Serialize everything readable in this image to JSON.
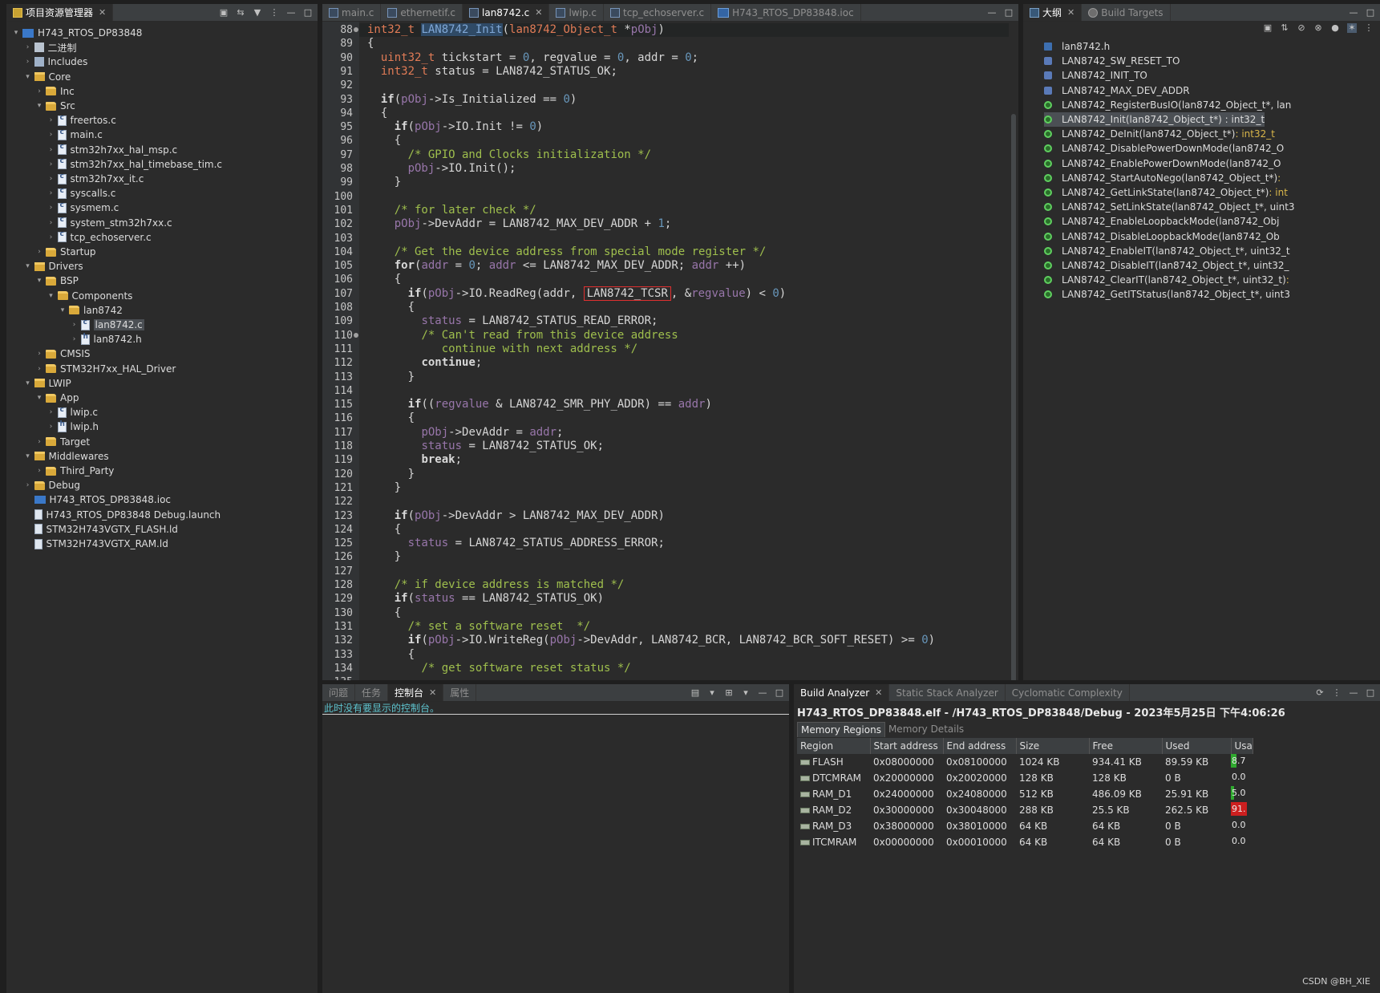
{
  "explorer": {
    "tab_label": "项目资源管理器",
    "tree": [
      {
        "depth": 0,
        "arrow": "▾",
        "icon": "ide",
        "label": "H743_RTOS_DP83848"
      },
      {
        "depth": 1,
        "arrow": "›",
        "icon": "bin",
        "label": "二进制"
      },
      {
        "depth": 1,
        "arrow": "›",
        "icon": "inc",
        "label": "Includes"
      },
      {
        "depth": 1,
        "arrow": "▾",
        "icon": "fold-src",
        "label": "Core"
      },
      {
        "depth": 2,
        "arrow": "›",
        "icon": "fold",
        "label": "Inc"
      },
      {
        "depth": 2,
        "arrow": "▾",
        "icon": "fold",
        "label": "Src"
      },
      {
        "depth": 3,
        "arrow": "›",
        "icon": "cfile",
        "label": "freertos.c"
      },
      {
        "depth": 3,
        "arrow": "›",
        "icon": "cfile",
        "label": "main.c"
      },
      {
        "depth": 3,
        "arrow": "›",
        "icon": "cfile",
        "label": "stm32h7xx_hal_msp.c"
      },
      {
        "depth": 3,
        "arrow": "›",
        "icon": "cfile",
        "label": "stm32h7xx_hal_timebase_tim.c"
      },
      {
        "depth": 3,
        "arrow": "›",
        "icon": "cfile",
        "label": "stm32h7xx_it.c"
      },
      {
        "depth": 3,
        "arrow": "›",
        "icon": "cfile",
        "label": "syscalls.c"
      },
      {
        "depth": 3,
        "arrow": "›",
        "icon": "cfile",
        "label": "sysmem.c"
      },
      {
        "depth": 3,
        "arrow": "›",
        "icon": "cfile",
        "label": "system_stm32h7xx.c"
      },
      {
        "depth": 3,
        "arrow": "›",
        "icon": "cfile",
        "label": "tcp_echoserver.c"
      },
      {
        "depth": 2,
        "arrow": "›",
        "icon": "fold",
        "label": "Startup"
      },
      {
        "depth": 1,
        "arrow": "▾",
        "icon": "fold-src",
        "label": "Drivers"
      },
      {
        "depth": 2,
        "arrow": "▾",
        "icon": "fold",
        "label": "BSP"
      },
      {
        "depth": 3,
        "arrow": "▾",
        "icon": "fold",
        "label": "Components"
      },
      {
        "depth": 4,
        "arrow": "▾",
        "icon": "fold",
        "label": "lan8742"
      },
      {
        "depth": 5,
        "arrow": "›",
        "icon": "cfile",
        "label": "lan8742.c",
        "selected": true
      },
      {
        "depth": 5,
        "arrow": "›",
        "icon": "hfile",
        "label": "lan8742.h"
      },
      {
        "depth": 2,
        "arrow": "›",
        "icon": "fold",
        "label": "CMSIS"
      },
      {
        "depth": 2,
        "arrow": "›",
        "icon": "fold",
        "label": "STM32H7xx_HAL_Driver"
      },
      {
        "depth": 1,
        "arrow": "▾",
        "icon": "fold-src",
        "label": "LWIP"
      },
      {
        "depth": 2,
        "arrow": "▾",
        "icon": "fold",
        "label": "App"
      },
      {
        "depth": 3,
        "arrow": "›",
        "icon": "cfile",
        "label": "lwip.c"
      },
      {
        "depth": 3,
        "arrow": "›",
        "icon": "hfile",
        "label": "lwip.h"
      },
      {
        "depth": 2,
        "arrow": "›",
        "icon": "fold",
        "label": "Target"
      },
      {
        "depth": 1,
        "arrow": "▾",
        "icon": "fold-src",
        "label": "Middlewares"
      },
      {
        "depth": 2,
        "arrow": "›",
        "icon": "fold",
        "label": "Third_Party"
      },
      {
        "depth": 1,
        "arrow": "›",
        "icon": "fold",
        "label": "Debug"
      },
      {
        "depth": 1,
        "arrow": "",
        "icon": "mx",
        "label": "H743_RTOS_DP83848.ioc"
      },
      {
        "depth": 1,
        "arrow": "",
        "icon": "doc",
        "label": "H743_RTOS_DP83848 Debug.launch"
      },
      {
        "depth": 1,
        "arrow": "",
        "icon": "doc",
        "label": "STM32H743VGTX_FLASH.ld"
      },
      {
        "depth": 1,
        "arrow": "",
        "icon": "doc",
        "label": "STM32H743VGTX_RAM.ld"
      }
    ]
  },
  "editor": {
    "tabs": [
      {
        "label": "main.c",
        "icon": "c",
        "active": false
      },
      {
        "label": "ethernetif.c",
        "icon": "c",
        "active": false
      },
      {
        "label": "lan8742.c",
        "icon": "c",
        "active": true
      },
      {
        "label": "lwip.c",
        "icon": "c",
        "active": false
      },
      {
        "label": "tcp_echoserver.c",
        "icon": "c",
        "active": false
      },
      {
        "label": "H743_RTOS_DP83848.ioc",
        "icon": "mx",
        "active": false
      }
    ],
    "lines": [
      {
        "n": "88",
        "html": "<span class=\"ty\">int32_t</span> <span class=\"fnsel\">LAN8742_Init</span>(<span class=\"ty\">lan8742_Object_t</span> *<span class=\"var\">pObj</span>)",
        "current": true,
        "mark": true
      },
      {
        "n": "89",
        "html": "{"
      },
      {
        "n": "90",
        "html": "  <span class=\"ty\">uint32_t</span> tickstart = <span class=\"num\">0</span>, regvalue = <span class=\"num\">0</span>, addr = <span class=\"num\">0</span>;"
      },
      {
        "n": "91",
        "html": "  <span class=\"ty\">int32_t</span> status = LAN8742_STATUS_OK;"
      },
      {
        "n": "92",
        "html": ""
      },
      {
        "n": "93",
        "html": "  <span class=\"kwp\">if</span>(<span class=\"var\">pObj</span>->Is_Initialized == <span class=\"num\">0</span>)"
      },
      {
        "n": "94",
        "html": "  {"
      },
      {
        "n": "95",
        "html": "    <span class=\"kwp\">if</span>(<span class=\"var\">pObj</span>->IO.Init != <span class=\"num\">0</span>)"
      },
      {
        "n": "96",
        "html": "    {"
      },
      {
        "n": "97",
        "html": "      <span class=\"cm\">/* GPIO and Clocks initialization */</span>"
      },
      {
        "n": "98",
        "html": "      <span class=\"var\">pObj</span>->IO.Init();"
      },
      {
        "n": "99",
        "html": "    }"
      },
      {
        "n": "100",
        "html": ""
      },
      {
        "n": "101",
        "html": "    <span class=\"cm\">/* for later check */</span>"
      },
      {
        "n": "102",
        "html": "    <span class=\"var\">pObj</span>->DevAddr = LAN8742_MAX_DEV_ADDR + <span class=\"num\">1</span>;"
      },
      {
        "n": "103",
        "html": ""
      },
      {
        "n": "104",
        "html": "    <span class=\"cm\">/* Get the device address from special mode register */</span>"
      },
      {
        "n": "105",
        "html": "    <span class=\"kwp\">for</span>(<span class=\"var\">addr</span> = <span class=\"num\">0</span>; <span class=\"var\">addr</span> <= LAN8742_MAX_DEV_ADDR; <span class=\"var\">addr</span> ++)"
      },
      {
        "n": "106",
        "html": "    {"
      },
      {
        "n": "107",
        "html": "      <span class=\"kwp\">if</span>(<span class=\"var\">pObj</span>->IO.ReadReg(addr, <span class=\"boxed\">LAN8742_TCSR</span>, &amp;<span class=\"var\">regvalue</span>) < <span class=\"num\">0</span>)"
      },
      {
        "n": "108",
        "html": "      {"
      },
      {
        "n": "109",
        "html": "        <span class=\"var\">status</span> = LAN8742_STATUS_READ_ERROR;"
      },
      {
        "n": "110",
        "html": "        <span class=\"cm\">/* Can't read from this device address</span>",
        "mark": true
      },
      {
        "n": "111",
        "html": "<span class=\"cm\">           continue with next address */</span>"
      },
      {
        "n": "112",
        "html": "        <span class=\"kwp\">continue</span>;"
      },
      {
        "n": "113",
        "html": "      }"
      },
      {
        "n": "114",
        "html": ""
      },
      {
        "n": "115",
        "html": "      <span class=\"kwp\">if</span>((<span class=\"var\">regvalue</span> &amp; LAN8742_SMR_PHY_ADDR) == <span class=\"var\">addr</span>)"
      },
      {
        "n": "116",
        "html": "      {"
      },
      {
        "n": "117",
        "html": "        <span class=\"var\">pObj</span>->DevAddr = <span class=\"var\">addr</span>;"
      },
      {
        "n": "118",
        "html": "        <span class=\"var\">status</span> = LAN8742_STATUS_OK;"
      },
      {
        "n": "119",
        "html": "        <span class=\"kwp\">break</span>;"
      },
      {
        "n": "120",
        "html": "      }"
      },
      {
        "n": "121",
        "html": "    }"
      },
      {
        "n": "122",
        "html": ""
      },
      {
        "n": "123",
        "html": "    <span class=\"kwp\">if</span>(<span class=\"var\">pObj</span>->DevAddr > LAN8742_MAX_DEV_ADDR)"
      },
      {
        "n": "124",
        "html": "    {"
      },
      {
        "n": "125",
        "html": "      <span class=\"var\">status</span> = LAN8742_STATUS_ADDRESS_ERROR;"
      },
      {
        "n": "126",
        "html": "    }"
      },
      {
        "n": "127",
        "html": ""
      },
      {
        "n": "128",
        "html": "    <span class=\"cm\">/* if device address is matched */</span>"
      },
      {
        "n": "129",
        "html": "    <span class=\"kwp\">if</span>(<span class=\"var\">status</span> == LAN8742_STATUS_OK)"
      },
      {
        "n": "130",
        "html": "    {"
      },
      {
        "n": "131",
        "html": "      <span class=\"cm\">/* set a software reset  */</span>"
      },
      {
        "n": "132",
        "html": "      <span class=\"kwp\">if</span>(<span class=\"var\">pObj</span>->IO.WriteReg(<span class=\"var\">pObj</span>->DevAddr, LAN8742_BCR, LAN8742_BCR_SOFT_RESET) >= <span class=\"num\">0</span>)"
      },
      {
        "n": "133",
        "html": "      {"
      },
      {
        "n": "134",
        "html": "        <span class=\"cm\">/* get software reset status */</span>"
      },
      {
        "n": "135",
        "html": ""
      }
    ]
  },
  "outline": {
    "tabs": [
      {
        "label": "大纲",
        "icon": "out",
        "active": true,
        "close": true
      },
      {
        "label": "Build Targets",
        "icon": "gear",
        "active": false,
        "close": false
      }
    ],
    "items": [
      {
        "icon": "file",
        "label": "lan8742.h",
        "ret": ""
      },
      {
        "icon": "def",
        "label": "LAN8742_SW_RESET_TO",
        "ret": ""
      },
      {
        "icon": "def",
        "label": "LAN8742_INIT_TO",
        "ret": ""
      },
      {
        "icon": "def",
        "label": "LAN8742_MAX_DEV_ADDR",
        "ret": ""
      },
      {
        "icon": "fn",
        "label": "LAN8742_RegisterBusIO(lan8742_Object_t*, lan",
        "ret": ""
      },
      {
        "icon": "fn",
        "label": "LAN8742_Init(lan8742_Object_t*) : int32_t",
        "ret": "",
        "selected": true
      },
      {
        "icon": "fn",
        "label": "LAN8742_DeInit(lan8742_Object_t*)",
        "ret": " : int32_t"
      },
      {
        "icon": "fn",
        "label": "LAN8742_DisablePowerDownMode(lan8742_O",
        "ret": ""
      },
      {
        "icon": "fn",
        "label": "LAN8742_EnablePowerDownMode(lan8742_O",
        "ret": ""
      },
      {
        "icon": "fn",
        "label": "LAN8742_StartAutoNego(lan8742_Object_t*)",
        "ret": " :"
      },
      {
        "icon": "fn",
        "label": "LAN8742_GetLinkState(lan8742_Object_t*)",
        "ret": " : int"
      },
      {
        "icon": "fn",
        "label": "LAN8742_SetLinkState(lan8742_Object_t*, uint3",
        "ret": ""
      },
      {
        "icon": "fn",
        "label": "LAN8742_EnableLoopbackMode(lan8742_Obj",
        "ret": ""
      },
      {
        "icon": "fn",
        "label": "LAN8742_DisableLoopbackMode(lan8742_Ob",
        "ret": ""
      },
      {
        "icon": "fn",
        "label": "LAN8742_EnableIT(lan8742_Object_t*, uint32_t",
        "ret": ""
      },
      {
        "icon": "fn",
        "label": "LAN8742_DisableIT(lan8742_Object_t*, uint32_",
        "ret": ""
      },
      {
        "icon": "fn",
        "label": "LAN8742_ClearIT(lan8742_Object_t*, uint32_t)",
        "ret": " :"
      },
      {
        "icon": "fn",
        "label": "LAN8742_GetITStatus(lan8742_Object_t*, uint3",
        "ret": ""
      }
    ]
  },
  "console": {
    "tabs": [
      {
        "label": "问题",
        "active": false
      },
      {
        "label": "任务",
        "active": false
      },
      {
        "label": "控制台",
        "active": true
      },
      {
        "label": "属性",
        "active": false
      }
    ],
    "message": "此时没有要显示的控制台。"
  },
  "build": {
    "tabs": [
      {
        "label": "Build Analyzer",
        "active": true
      },
      {
        "label": "Static Stack Analyzer",
        "active": false
      },
      {
        "label": "Cyclomatic Complexity",
        "active": false
      }
    ],
    "title": "H743_RTOS_DP83848.elf - /H743_RTOS_DP83848/Debug - 2023年5月25日 下午4:06:26",
    "subtabs": [
      "Memory Regions",
      "Memory Details"
    ],
    "columns": [
      "Region",
      "Start address",
      "End address",
      "Size",
      "Free",
      "Used",
      "Usa"
    ],
    "rows": [
      {
        "region": "FLASH",
        "start": "0x08000000",
        "end": "0x08100000",
        "size": "1024 KB",
        "free": "934.41 KB",
        "used": "89.59 KB",
        "usage": "8.7",
        "pct": 8.75
      },
      {
        "region": "DTCMRAM",
        "start": "0x20000000",
        "end": "0x20020000",
        "size": "128 KB",
        "free": "128 KB",
        "used": "0 B",
        "usage": "0.0",
        "pct": 0
      },
      {
        "region": "RAM_D1",
        "start": "0x24000000",
        "end": "0x24080000",
        "size": "512 KB",
        "free": "486.09 KB",
        "used": "25.91 KB",
        "usage": "5.0",
        "pct": 5.06
      },
      {
        "region": "RAM_D2",
        "start": "0x30000000",
        "end": "0x30048000",
        "size": "288 KB",
        "free": "25.5 KB",
        "used": "262.5 KB",
        "usage": "91.",
        "pct": 91.15
      },
      {
        "region": "RAM_D3",
        "start": "0x38000000",
        "end": "0x38010000",
        "size": "64 KB",
        "free": "64 KB",
        "used": "0 B",
        "usage": "0.0",
        "pct": 0
      },
      {
        "region": "ITCMRAM",
        "start": "0x00000000",
        "end": "0x00010000",
        "size": "64 KB",
        "free": "64 KB",
        "used": "0 B",
        "usage": "0.0",
        "pct": 0
      }
    ],
    "colors": {
      "usage_ok": "#2faa2f",
      "usage_high": "#cc1f1f"
    }
  },
  "watermark": "CSDN @BH_XIE"
}
